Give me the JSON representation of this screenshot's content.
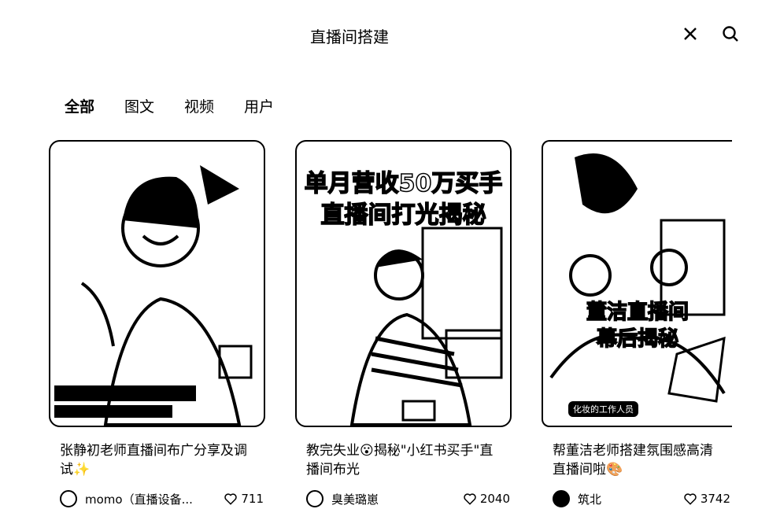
{
  "header": {
    "title": "直播间搭建",
    "close_icon": "close-icon",
    "search_icon": "search-icon"
  },
  "tabs": [
    "全部",
    "图文",
    "视频",
    "用户"
  ],
  "cards": [
    {
      "caption": "张静初老师直播间布广分享及调试✨",
      "author": "momo（直播设备...",
      "likes": "711"
    },
    {
      "caption": "教完失业😮揭秘\"小红书买手\"直播间布光",
      "author": "臭美璐崽",
      "likes": "2040",
      "overlay_line1": "单月营收50万买手",
      "overlay_line2": "直播间打光揭秘"
    },
    {
      "caption": "帮董洁老师搭建氛围感高清直播间啦🎨",
      "author": "筑北",
      "likes": "3742",
      "overlay_line1": "董洁直播间",
      "overlay_line2": "幕后揭秘",
      "overlay_tag": "化妆的工作人员"
    }
  ]
}
